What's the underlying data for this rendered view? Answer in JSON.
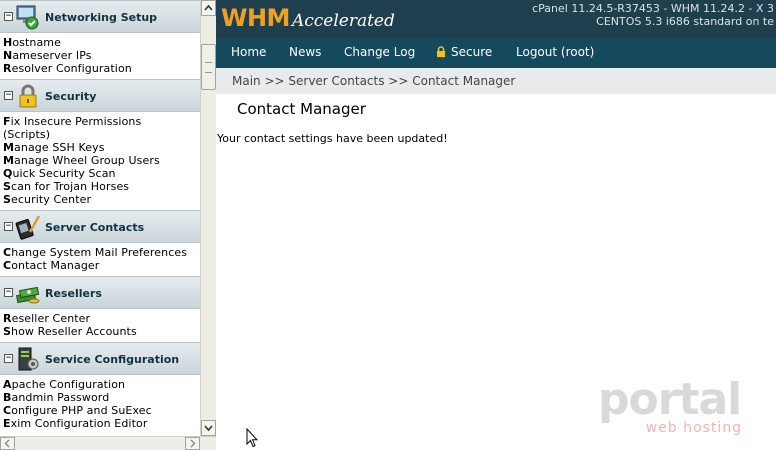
{
  "sidebar": {
    "sections": [
      {
        "title": "Networking Setup",
        "icon": "network-monitor-icon",
        "items": [
          {
            "first": "H",
            "rest": "ostname"
          },
          {
            "first": "N",
            "rest": "ameserver IPs"
          },
          {
            "first": "R",
            "rest": "esolver Configuration"
          }
        ]
      },
      {
        "title": "Security",
        "icon": "padlock-icon",
        "items": [
          {
            "first": "F",
            "rest": "ix Insecure Permissions"
          },
          {
            "first": "",
            "rest": "(Scripts)"
          },
          {
            "first": "M",
            "rest": "anage SSH Keys"
          },
          {
            "first": "M",
            "rest": "anage Wheel Group Users"
          },
          {
            "first": "Q",
            "rest": "uick Security Scan"
          },
          {
            "first": "S",
            "rest": "can for Trojan Horses"
          },
          {
            "first": "S",
            "rest": "ecurity Center"
          }
        ]
      },
      {
        "title": "Server Contacts",
        "icon": "pda-pen-icon",
        "items": [
          {
            "first": "C",
            "rest": "hange System Mail Preferences"
          },
          {
            "first": "C",
            "rest": "ontact Manager"
          }
        ]
      },
      {
        "title": "Resellers",
        "icon": "money-stack-icon",
        "items": [
          {
            "first": "R",
            "rest": "eseller Center"
          },
          {
            "first": "S",
            "rest": "how Reseller Accounts"
          }
        ]
      },
      {
        "title": "Service Configuration",
        "icon": "server-gear-icon",
        "items": [
          {
            "first": "A",
            "rest": "pache Configuration"
          },
          {
            "first": "B",
            "rest": "andmin Password"
          },
          {
            "first": "C",
            "rest": "onfigure PHP and SuExec"
          },
          {
            "first": "E",
            "rest": "xim Configuration Editor"
          }
        ]
      }
    ],
    "toggle_symbol": "−"
  },
  "header": {
    "logo_whm": "WHM",
    "logo_accelerated": "Accelerated",
    "version_line1": "cPanel 11.24.5-R37453 - WHM 11.24.2 - X 3",
    "version_line2": "CENTOS 5.3 i686 standard on te"
  },
  "nav": {
    "home": "Home",
    "news": "News",
    "changelog": "Change Log",
    "secure": "Secure",
    "logout": "Logout (root)"
  },
  "breadcrumb": "Main >> Server Contacts >> Contact Manager",
  "main": {
    "title": "Contact Manager",
    "message": "Your contact settings have been updated!"
  },
  "watermark": {
    "top": "portal",
    "bottom": "web hosting"
  },
  "colors": {
    "topbar": "#1f3f4e",
    "navbar": "#14495e",
    "logo_accent": "#f0a020"
  }
}
